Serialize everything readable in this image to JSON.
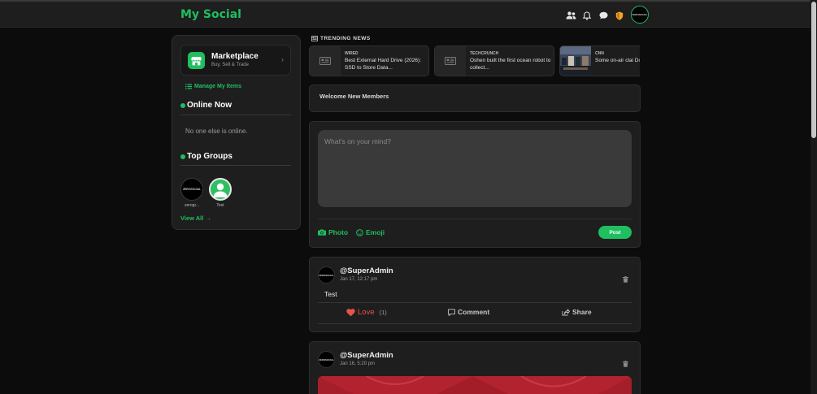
{
  "app": {
    "brand": "My Social"
  },
  "header": {
    "icons": [
      "users-icon",
      "bell-icon",
      "chat-icon",
      "shield-icon"
    ],
    "avatar_label": "ZEROSOCIAL"
  },
  "sidebar": {
    "marketplace": {
      "title": "Marketplace",
      "subtitle": "Buy, Sell & Trade"
    },
    "manage_items": "Manage My Items",
    "online": {
      "title": "Online Now",
      "empty": "No one else is online."
    },
    "groups": {
      "title": "Top Groups",
      "items": [
        {
          "name": "zerogr...",
          "logo": "ZEROSOCIAL"
        },
        {
          "name": "Test"
        }
      ],
      "view_all": "View All →"
    }
  },
  "trending": {
    "title": "TRENDING NEWS",
    "items": [
      {
        "source": "WIRED",
        "headline": "Best External Hard Drive (2026): SSD to Store Data..."
      },
      {
        "source": "TECHCRUNCH",
        "headline": "Oshen built the first ocean robot to collect..."
      },
      {
        "source": "CNN",
        "headline": "Some on-air clai Dominion Voting"
      }
    ]
  },
  "welcome": {
    "title": "Welcome New Members"
  },
  "composer": {
    "placeholder": "What's on your mind?",
    "photo": "Photo",
    "emoji": "Emoji",
    "post": "Post"
  },
  "posts": [
    {
      "user": "@SuperAdmin",
      "time": "Jan 17, 12:17 pm",
      "text": "Test",
      "love_label": "Love",
      "love_count": "(1)",
      "comment_label": "Comment",
      "share_label": "Share"
    },
    {
      "user": "@SuperAdmin",
      "time": "Jan 16, 5:20 pm"
    }
  ],
  "colors": {
    "accent": "#1fbf60",
    "love": "#e5534b",
    "background": "#0c0c0c",
    "card": "#1e1e1e"
  }
}
